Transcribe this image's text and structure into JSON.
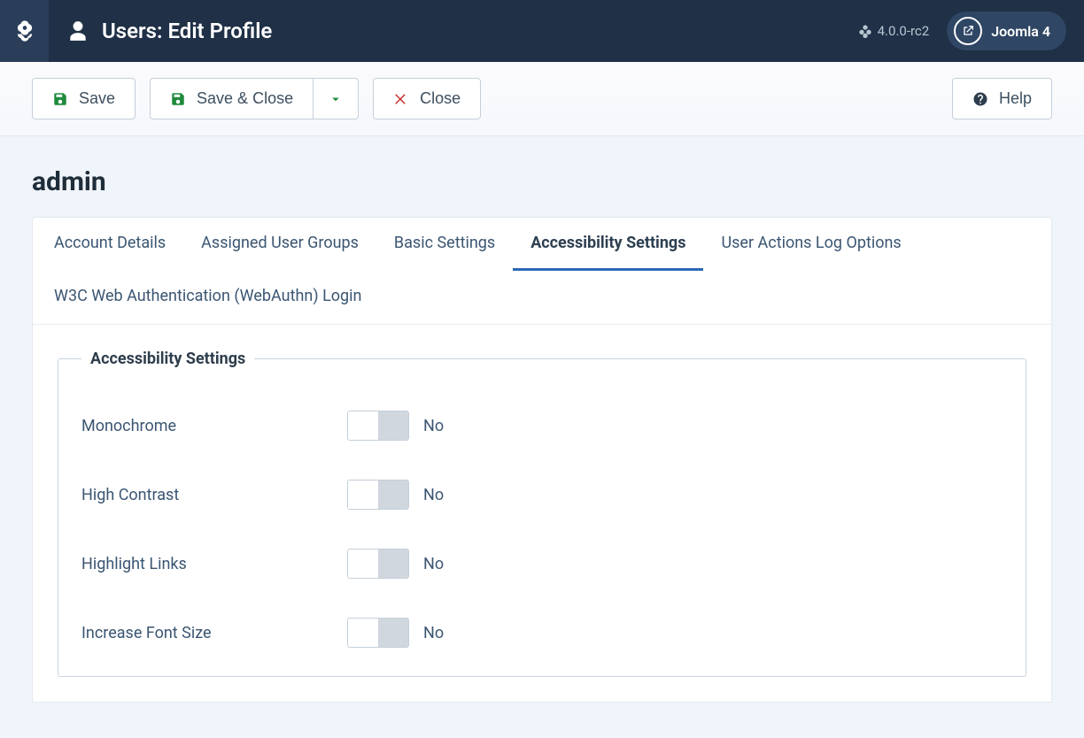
{
  "header": {
    "page_title": "Users: Edit Profile",
    "version_label": "4.0.0-rc2",
    "brand_label": "Joomla 4"
  },
  "toolbar": {
    "save_label": "Save",
    "save_close_label": "Save & Close",
    "close_label": "Close",
    "help_label": "Help"
  },
  "content": {
    "heading": "admin",
    "tabs": [
      {
        "label": "Account Details",
        "active": false
      },
      {
        "label": "Assigned User Groups",
        "active": false
      },
      {
        "label": "Basic Settings",
        "active": false
      },
      {
        "label": "Accessibility Settings",
        "active": true
      },
      {
        "label": "User Actions Log Options",
        "active": false
      },
      {
        "label": "W3C Web Authentication (WebAuthn) Login",
        "active": false
      }
    ],
    "fieldset_legend": "Accessibility Settings",
    "fields": [
      {
        "label": "Monochrome",
        "value": "No"
      },
      {
        "label": "High Contrast",
        "value": "No"
      },
      {
        "label": "Highlight Links",
        "value": "No"
      },
      {
        "label": "Increase Font Size",
        "value": "No"
      }
    ]
  }
}
